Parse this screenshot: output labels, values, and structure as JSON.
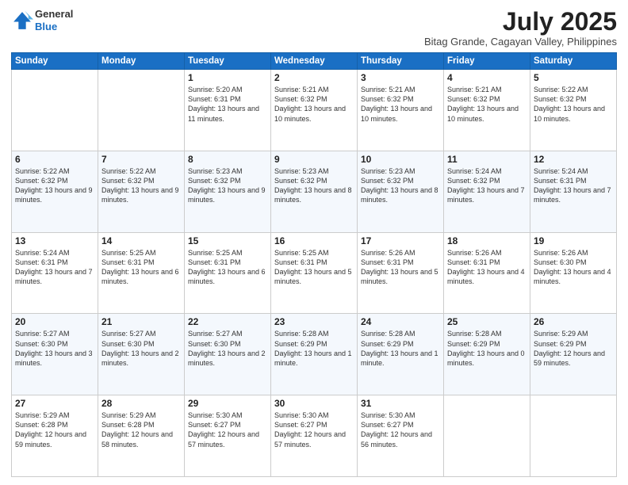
{
  "header": {
    "logo_line1": "General",
    "logo_line2": "Blue",
    "month_year": "July 2025",
    "location": "Bitag Grande, Cagayan Valley, Philippines"
  },
  "weekdays": [
    "Sunday",
    "Monday",
    "Tuesday",
    "Wednesday",
    "Thursday",
    "Friday",
    "Saturday"
  ],
  "weeks": [
    [
      {
        "day": "",
        "detail": ""
      },
      {
        "day": "",
        "detail": ""
      },
      {
        "day": "1",
        "detail": "Sunrise: 5:20 AM\nSunset: 6:31 PM\nDaylight: 13 hours and 11 minutes."
      },
      {
        "day": "2",
        "detail": "Sunrise: 5:21 AM\nSunset: 6:32 PM\nDaylight: 13 hours and 10 minutes."
      },
      {
        "day": "3",
        "detail": "Sunrise: 5:21 AM\nSunset: 6:32 PM\nDaylight: 13 hours and 10 minutes."
      },
      {
        "day": "4",
        "detail": "Sunrise: 5:21 AM\nSunset: 6:32 PM\nDaylight: 13 hours and 10 minutes."
      },
      {
        "day": "5",
        "detail": "Sunrise: 5:22 AM\nSunset: 6:32 PM\nDaylight: 13 hours and 10 minutes."
      }
    ],
    [
      {
        "day": "6",
        "detail": "Sunrise: 5:22 AM\nSunset: 6:32 PM\nDaylight: 13 hours and 9 minutes."
      },
      {
        "day": "7",
        "detail": "Sunrise: 5:22 AM\nSunset: 6:32 PM\nDaylight: 13 hours and 9 minutes."
      },
      {
        "day": "8",
        "detail": "Sunrise: 5:23 AM\nSunset: 6:32 PM\nDaylight: 13 hours and 9 minutes."
      },
      {
        "day": "9",
        "detail": "Sunrise: 5:23 AM\nSunset: 6:32 PM\nDaylight: 13 hours and 8 minutes."
      },
      {
        "day": "10",
        "detail": "Sunrise: 5:23 AM\nSunset: 6:32 PM\nDaylight: 13 hours and 8 minutes."
      },
      {
        "day": "11",
        "detail": "Sunrise: 5:24 AM\nSunset: 6:32 PM\nDaylight: 13 hours and 7 minutes."
      },
      {
        "day": "12",
        "detail": "Sunrise: 5:24 AM\nSunset: 6:31 PM\nDaylight: 13 hours and 7 minutes."
      }
    ],
    [
      {
        "day": "13",
        "detail": "Sunrise: 5:24 AM\nSunset: 6:31 PM\nDaylight: 13 hours and 7 minutes."
      },
      {
        "day": "14",
        "detail": "Sunrise: 5:25 AM\nSunset: 6:31 PM\nDaylight: 13 hours and 6 minutes."
      },
      {
        "day": "15",
        "detail": "Sunrise: 5:25 AM\nSunset: 6:31 PM\nDaylight: 13 hours and 6 minutes."
      },
      {
        "day": "16",
        "detail": "Sunrise: 5:25 AM\nSunset: 6:31 PM\nDaylight: 13 hours and 5 minutes."
      },
      {
        "day": "17",
        "detail": "Sunrise: 5:26 AM\nSunset: 6:31 PM\nDaylight: 13 hours and 5 minutes."
      },
      {
        "day": "18",
        "detail": "Sunrise: 5:26 AM\nSunset: 6:31 PM\nDaylight: 13 hours and 4 minutes."
      },
      {
        "day": "19",
        "detail": "Sunrise: 5:26 AM\nSunset: 6:30 PM\nDaylight: 13 hours and 4 minutes."
      }
    ],
    [
      {
        "day": "20",
        "detail": "Sunrise: 5:27 AM\nSunset: 6:30 PM\nDaylight: 13 hours and 3 minutes."
      },
      {
        "day": "21",
        "detail": "Sunrise: 5:27 AM\nSunset: 6:30 PM\nDaylight: 13 hours and 2 minutes."
      },
      {
        "day": "22",
        "detail": "Sunrise: 5:27 AM\nSunset: 6:30 PM\nDaylight: 13 hours and 2 minutes."
      },
      {
        "day": "23",
        "detail": "Sunrise: 5:28 AM\nSunset: 6:29 PM\nDaylight: 13 hours and 1 minute."
      },
      {
        "day": "24",
        "detail": "Sunrise: 5:28 AM\nSunset: 6:29 PM\nDaylight: 13 hours and 1 minute."
      },
      {
        "day": "25",
        "detail": "Sunrise: 5:28 AM\nSunset: 6:29 PM\nDaylight: 13 hours and 0 minutes."
      },
      {
        "day": "26",
        "detail": "Sunrise: 5:29 AM\nSunset: 6:29 PM\nDaylight: 12 hours and 59 minutes."
      }
    ],
    [
      {
        "day": "27",
        "detail": "Sunrise: 5:29 AM\nSunset: 6:28 PM\nDaylight: 12 hours and 59 minutes."
      },
      {
        "day": "28",
        "detail": "Sunrise: 5:29 AM\nSunset: 6:28 PM\nDaylight: 12 hours and 58 minutes."
      },
      {
        "day": "29",
        "detail": "Sunrise: 5:30 AM\nSunset: 6:27 PM\nDaylight: 12 hours and 57 minutes."
      },
      {
        "day": "30",
        "detail": "Sunrise: 5:30 AM\nSunset: 6:27 PM\nDaylight: 12 hours and 57 minutes."
      },
      {
        "day": "31",
        "detail": "Sunrise: 5:30 AM\nSunset: 6:27 PM\nDaylight: 12 hours and 56 minutes."
      },
      {
        "day": "",
        "detail": ""
      },
      {
        "day": "",
        "detail": ""
      }
    ]
  ]
}
